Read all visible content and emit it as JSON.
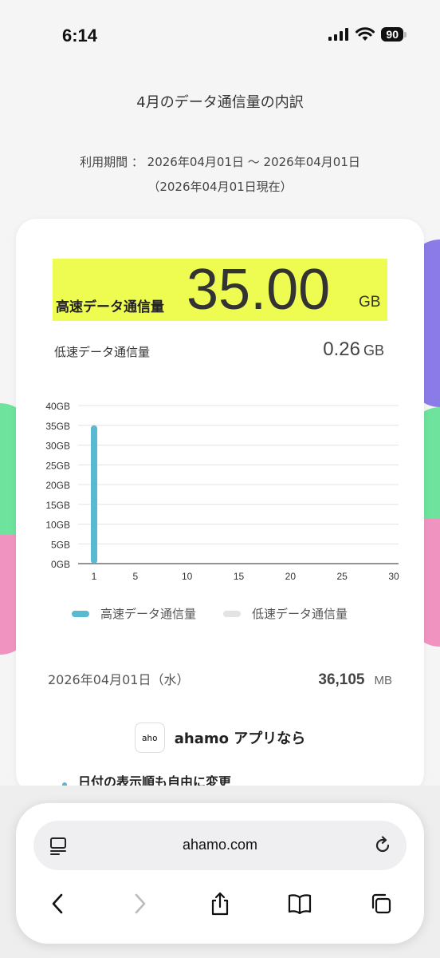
{
  "status_bar": {
    "time": "6:14",
    "battery": "90"
  },
  "page": {
    "title": "4月のデータ通信量の内訳",
    "period_line1": "利用期間 ： 2026年04月01日 〜 2026年04月01日",
    "period_line2": "（2026年04月01日現在）"
  },
  "usage": {
    "high_speed_label": "高速データ通信量",
    "high_speed_value": "35.00",
    "high_speed_unit": "GB",
    "low_speed_label": "低速データ通信量",
    "low_speed_value": "0.26",
    "low_speed_unit": "GB"
  },
  "chart_data": {
    "type": "bar",
    "x_ticks": [
      "1",
      "5",
      "10",
      "15",
      "20",
      "25",
      "30"
    ],
    "y_ticks": [
      "0GB",
      "5GB",
      "10GB",
      "15GB",
      "20GB",
      "25GB",
      "30GB",
      "35GB",
      "40GB"
    ],
    "ylim": [
      0,
      40
    ],
    "xlim": [
      1,
      30
    ],
    "series": [
      {
        "name": "高速データ通信量",
        "color": "#58b9d0",
        "points": [
          {
            "x": 1,
            "y": 35
          }
        ]
      },
      {
        "name": "低速データ通信量",
        "color": "#e3e3e3",
        "points": []
      }
    ],
    "grid": true
  },
  "daily": {
    "date": "2026年04月01日（水）",
    "amount": "36,105",
    "unit": "MB"
  },
  "promo": {
    "logo": "aho",
    "title": "ahamo アプリなら",
    "bullet": "日付の表示順も自由に変更"
  },
  "browser": {
    "url": "ahamo.com"
  }
}
